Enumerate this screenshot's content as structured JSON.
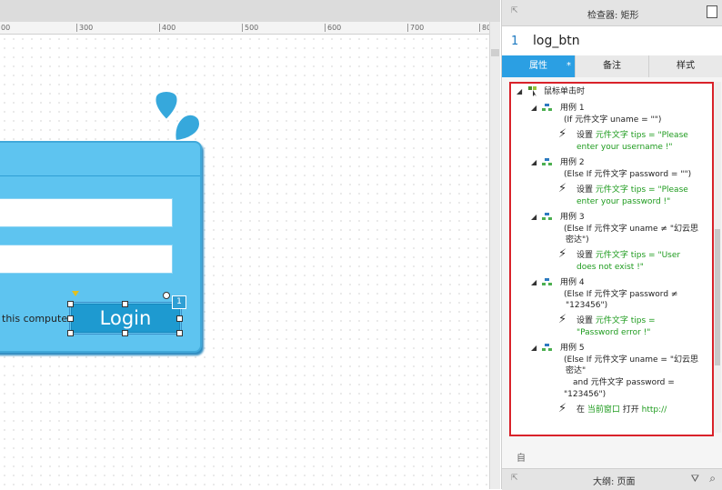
{
  "ruler": {
    "ticks": [
      "00",
      "300",
      "400",
      "500",
      "600",
      "700",
      "80"
    ]
  },
  "login": {
    "remember_text": "this computer",
    "button_label": "Login",
    "badge": "1"
  },
  "inspector": {
    "title": "检查器: 矩形",
    "widget_number": "1",
    "widget_name": "log_btn",
    "tabs": [
      "属性",
      "备注",
      "样式"
    ],
    "active_tab_marker": "*",
    "event_name": "鼠标单击时",
    "cases": [
      {
        "label": "用例 1",
        "condition": [
          "(If 元件文字 uname = \"\")"
        ],
        "action_prefix": "设置",
        "action_lines": [
          "元件文字 tips = \"Please",
          "enter your username !\""
        ]
      },
      {
        "label": "用例 2",
        "condition": [
          "(Else If 元件文字 password = \"\")"
        ],
        "action_prefix": "设置",
        "action_lines": [
          "元件文字 tips = \"Please",
          "enter your password !\""
        ]
      },
      {
        "label": "用例 3",
        "condition": [
          "(Else If 元件文字 uname ≠ \"幻云思",
          "密达\")"
        ],
        "action_prefix": "设置",
        "action_lines": [
          "元件文字 tips = \"User",
          "does not exist !\""
        ]
      },
      {
        "label": "用例 4",
        "condition": [
          "(Else If 元件文字 password ≠",
          "\"123456\")"
        ],
        "action_prefix": "设置",
        "action_lines": [
          "元件文字 tips =",
          "\"Password error !\""
        ]
      },
      {
        "label": "用例 5",
        "condition": [
          "(Else If 元件文字 uname = \"幻云思",
          "密达\"",
          "and 元件文字 password =",
          "\"123456\")"
        ],
        "action_prefix": "在",
        "action_green": "当前窗口",
        "action_mid": "打开",
        "action_url": "http://"
      }
    ],
    "footer_left": "自",
    "outline_label": "大纲: 页面"
  },
  "colors": {
    "accent": "#2b9fe3",
    "panel": "#5ec4f0",
    "highlight_border": "#d9222a",
    "action_green": "#1e9b1e"
  }
}
